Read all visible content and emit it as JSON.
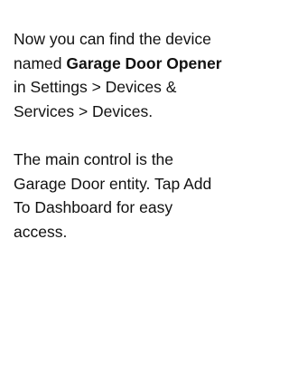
{
  "message": {
    "paragraph1": {
      "part1": "Now you can find the device named ",
      "device_name": "Garage Door Opener",
      "part2": " in Settings > Devices & Services > Devices."
    },
    "paragraph2": "The main control is the Garage Door entity. Tap Add To Dashboard for easy access."
  }
}
